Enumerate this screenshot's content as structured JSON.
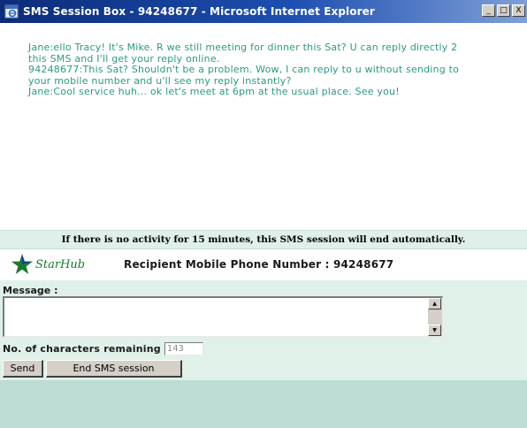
{
  "window": {
    "title": "SMS Session Box - 94248677 - Microsoft Internet Explorer",
    "minimize_glyph": "_",
    "maximize_glyph": "□",
    "close_glyph": "X"
  },
  "conversation": {
    "lines": [
      "Jane:ello Tracy! It's Mike. R we still meeting for dinner this Sat? U can reply directly 2",
      "this SMS and I'll get your reply online.",
      "94248677:This Sat? Shouldn't be a problem. Wow, I can reply to u without sending to",
      "your mobile number and u'll see my reply instantly?",
      "Jane:Cool service huh... ok let's meet at 6pm at the usual place. See you!"
    ]
  },
  "info_notice": "If there is no activity for 15 minutes, this SMS session will end automatically.",
  "logo": {
    "text": "StarHub"
  },
  "recipient": {
    "label": "Recipient Mobile Phone Number : 94248677"
  },
  "message": {
    "label": "Message :",
    "value": "",
    "scroll_up_glyph": "▲",
    "scroll_down_glyph": "▼"
  },
  "characters": {
    "label": "No. of characters remaining",
    "value": "143"
  },
  "buttons": {
    "send": "Send",
    "end_session": "End SMS session"
  },
  "colors": {
    "conversation_text": "#2a9a85",
    "panel_background": "#e0f1ea",
    "bottom_strip": "#bcdcd4",
    "titlebar": "#0b2c7a",
    "logo_green": "#1a7a2e"
  }
}
